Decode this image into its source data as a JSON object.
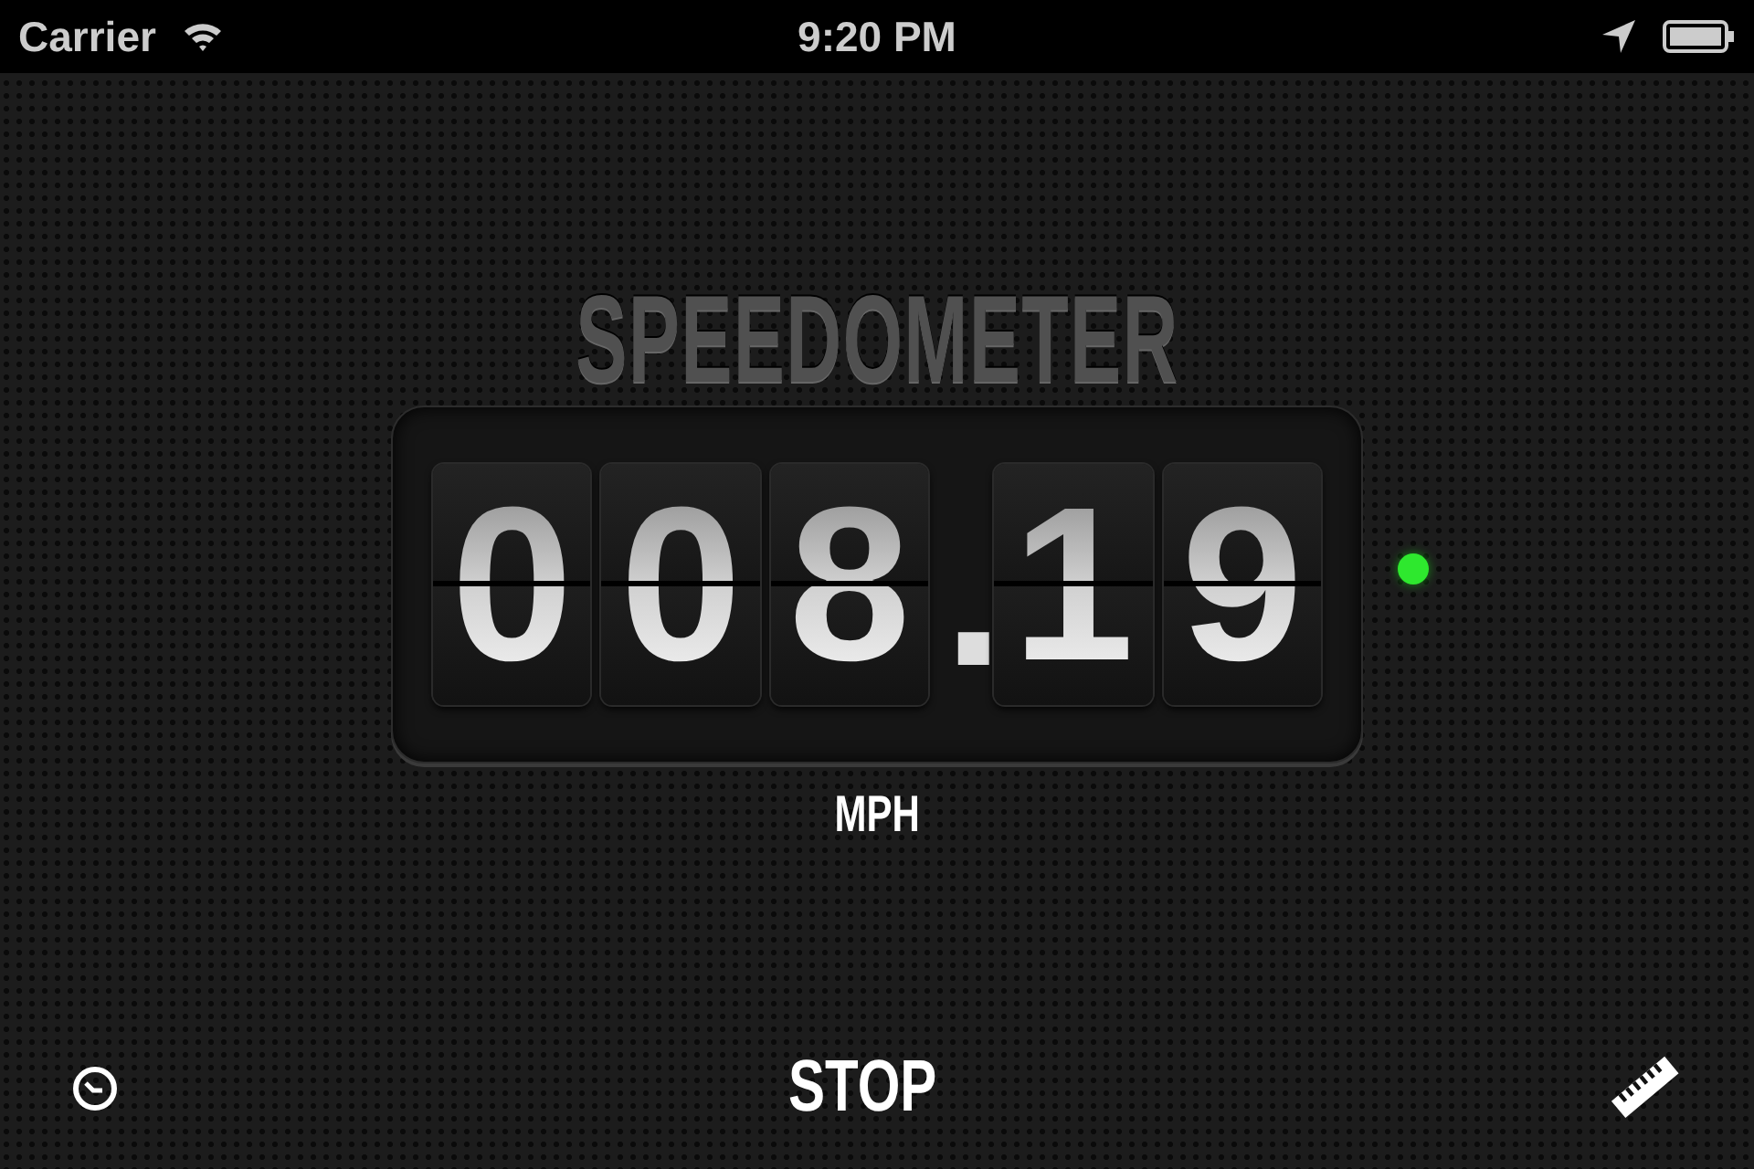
{
  "status_bar": {
    "carrier": "Carrier",
    "time": "9:20 PM"
  },
  "title": "SPEEDOMETER",
  "display": {
    "digits": [
      {
        "kind": "digit",
        "text": "0"
      },
      {
        "kind": "digit",
        "text": "0"
      },
      {
        "kind": "digit",
        "text": "8"
      },
      {
        "kind": "point",
        "text": "."
      },
      {
        "kind": "digit",
        "text": "1"
      },
      {
        "kind": "digit",
        "text": "9"
      }
    ],
    "indicator": {
      "on": true,
      "color": "#2ee82e"
    }
  },
  "unit": "MPH",
  "toolbar": {
    "stop_button": "STOP"
  }
}
